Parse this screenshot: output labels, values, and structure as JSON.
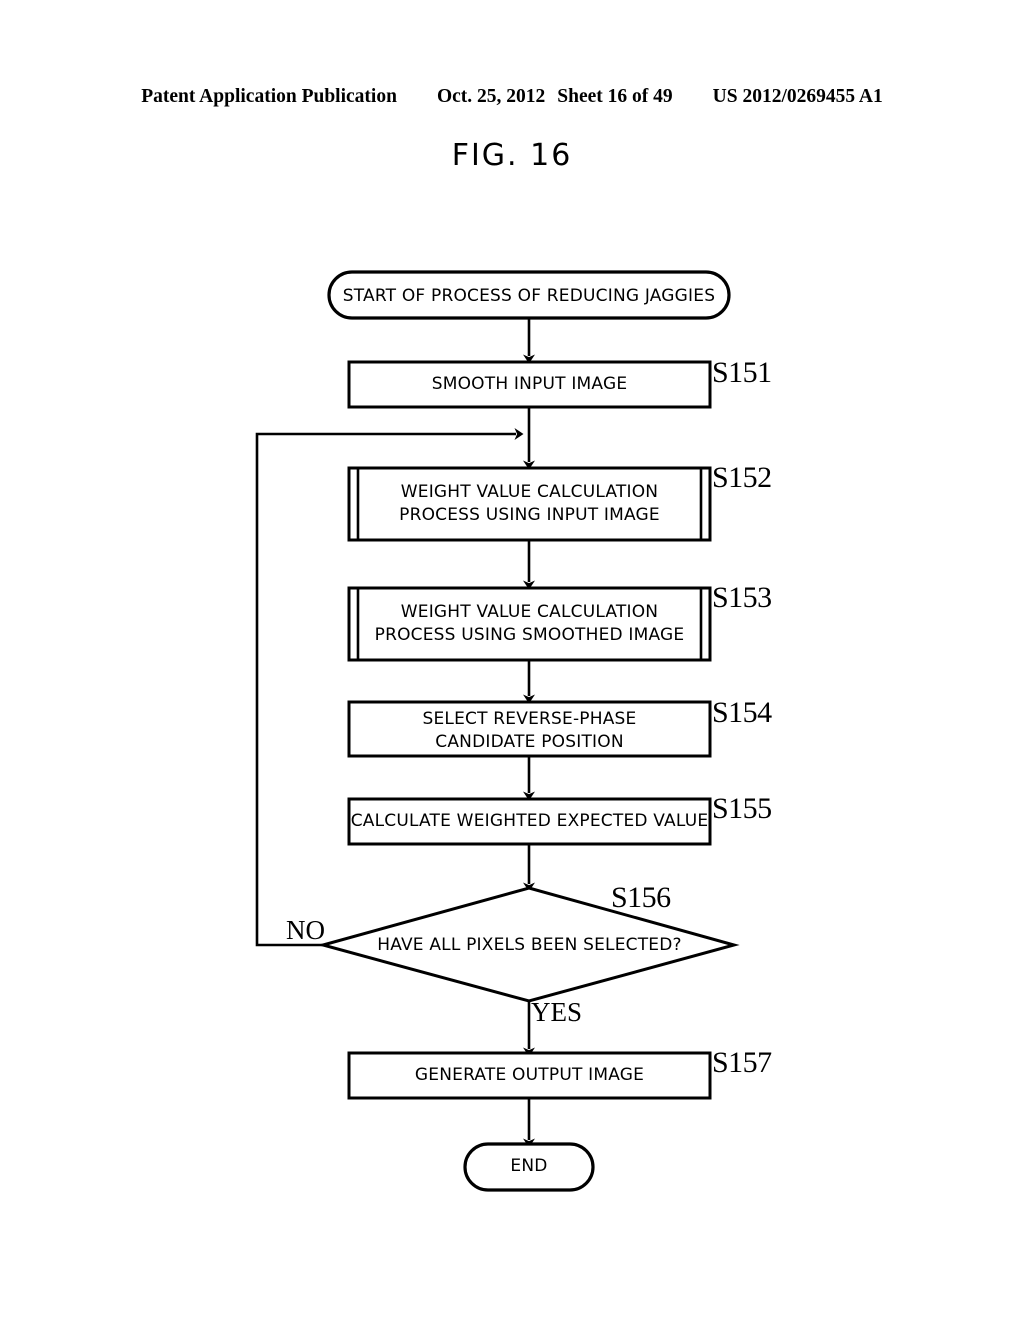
{
  "header": {
    "publication": "Patent Application Publication",
    "date": "Oct. 25, 2012",
    "sheet": "Sheet 16 of 49",
    "number": "US 2012/0269455 A1"
  },
  "figure": {
    "title": "FIG. 16"
  },
  "flowchart": {
    "start": {
      "label": "START OF PROCESS OF REDUCING JAGGIES",
      "shape": "terminator"
    },
    "end": {
      "label": "END",
      "shape": "terminator"
    },
    "steps": [
      {
        "id": "S151",
        "label": "SMOOTH INPUT IMAGE",
        "shape": "process"
      },
      {
        "id": "S152",
        "label": "WEIGHT VALUE CALCULATION\nPROCESS USING INPUT IMAGE",
        "shape": "predefined-process"
      },
      {
        "id": "S153",
        "label": "WEIGHT VALUE CALCULATION\nPROCESS USING SMOOTHED IMAGE",
        "shape": "predefined-process"
      },
      {
        "id": "S154",
        "label": "SELECT REVERSE-PHASE\nCANDIDATE POSITION",
        "shape": "process"
      },
      {
        "id": "S155",
        "label": "CALCULATE WEIGHTED EXPECTED VALUE",
        "shape": "process"
      },
      {
        "id": "S156",
        "label": "HAVE ALL PIXELS BEEN SELECTED?",
        "shape": "decision"
      },
      {
        "id": "S157",
        "label": "GENERATE OUTPUT IMAGE",
        "shape": "process"
      }
    ],
    "branches": {
      "no": "NO",
      "yes": "YES"
    }
  }
}
